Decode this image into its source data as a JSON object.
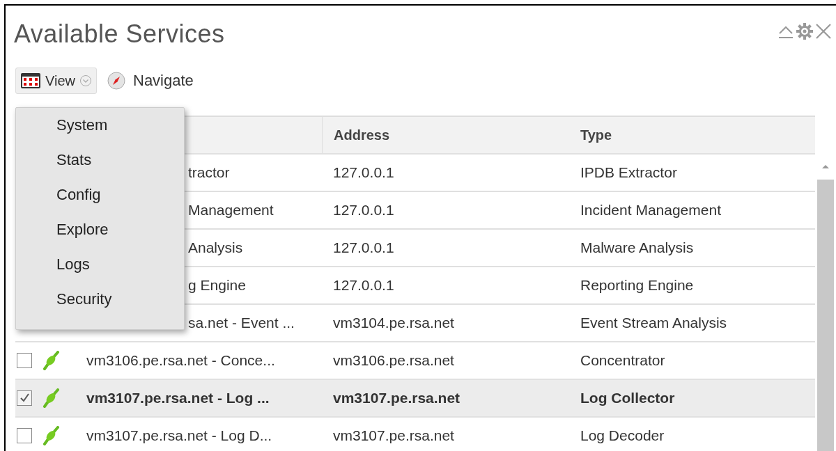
{
  "panel": {
    "title": "Available Services"
  },
  "toolbar": {
    "view_label": "View",
    "navigate_label": "Navigate"
  },
  "view_menu": {
    "items": [
      "System",
      "Stats",
      "Config",
      "Explore",
      "Logs",
      "Security"
    ]
  },
  "table": {
    "columns": [
      "Address",
      "Type"
    ],
    "rows": [
      {
        "kind": "covered",
        "name": "tractor",
        "address": "127.0.0.1",
        "type": "IPDB Extractor",
        "selected": false
      },
      {
        "kind": "covered",
        "name": "Management",
        "address": "127.0.0.1",
        "type": "Incident Management",
        "selected": false
      },
      {
        "kind": "covered",
        "name": "Analysis",
        "address": "127.0.0.1",
        "type": "Malware Analysis",
        "selected": false
      },
      {
        "kind": "covered",
        "name": "g Engine",
        "address": "127.0.0.1",
        "type": "Reporting Engine",
        "selected": false
      },
      {
        "kind": "covered",
        "name": "sa.net - Event ...",
        "address": "vm3104.pe.rsa.net",
        "type": "Event Stream Analysis",
        "selected": false
      },
      {
        "kind": "full",
        "name": "vm3106.pe.rsa.net - Conce...",
        "address": "vm3106.pe.rsa.net",
        "type": "Concentrator",
        "checked": false,
        "selected": false
      },
      {
        "kind": "full",
        "name": "vm3107.pe.rsa.net - Log ...",
        "address": "vm3107.pe.rsa.net",
        "type": "Log Collector",
        "checked": true,
        "selected": true
      },
      {
        "kind": "full",
        "name": "vm3107.pe.rsa.net - Log D...",
        "address": "vm3107.pe.rsa.net",
        "type": "Log Decoder",
        "checked": false,
        "selected": false
      }
    ]
  }
}
